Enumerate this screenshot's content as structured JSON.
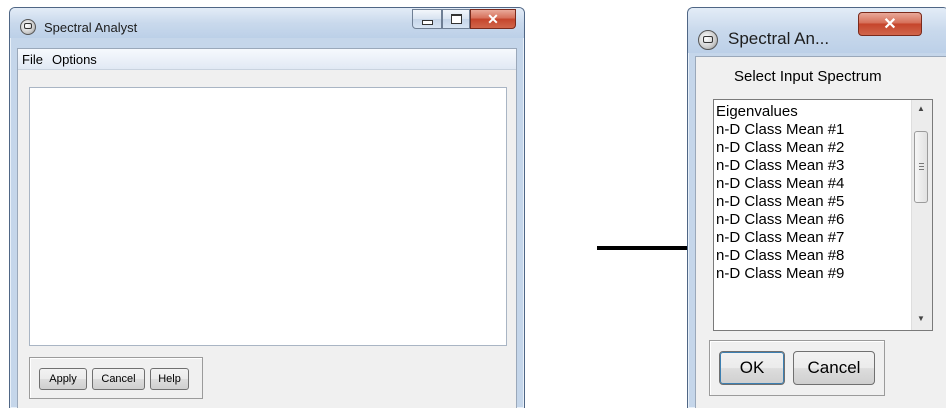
{
  "left_window": {
    "title": "Spectral Analyst",
    "menu": [
      "File",
      "Options"
    ],
    "buttons": {
      "apply": "Apply",
      "cancel": "Cancel",
      "help": "Help"
    },
    "caption_icons": [
      "minimize-icon",
      "maximize-icon",
      "close-icon"
    ]
  },
  "right_window": {
    "title": "Spectral An...",
    "label": "Select Input Spectrum",
    "items": [
      "Eigenvalues",
      "n-D Class Mean #1",
      "n-D Class Mean #2",
      "n-D Class Mean #3",
      "n-D Class Mean #4",
      "n-D Class Mean #5",
      "n-D Class Mean #6",
      "n-D Class Mean #7",
      "n-D Class Mean #8",
      "n-D Class Mean #9"
    ],
    "buttons": {
      "ok": "OK",
      "cancel": "Cancel"
    },
    "caption_icons": [
      "close-icon"
    ]
  },
  "annotation": {
    "icon": "arrow-right-icon",
    "color": "#000000"
  },
  "colors": {
    "close_button": "#c5452c",
    "window_frame": "#c5d6ea"
  }
}
